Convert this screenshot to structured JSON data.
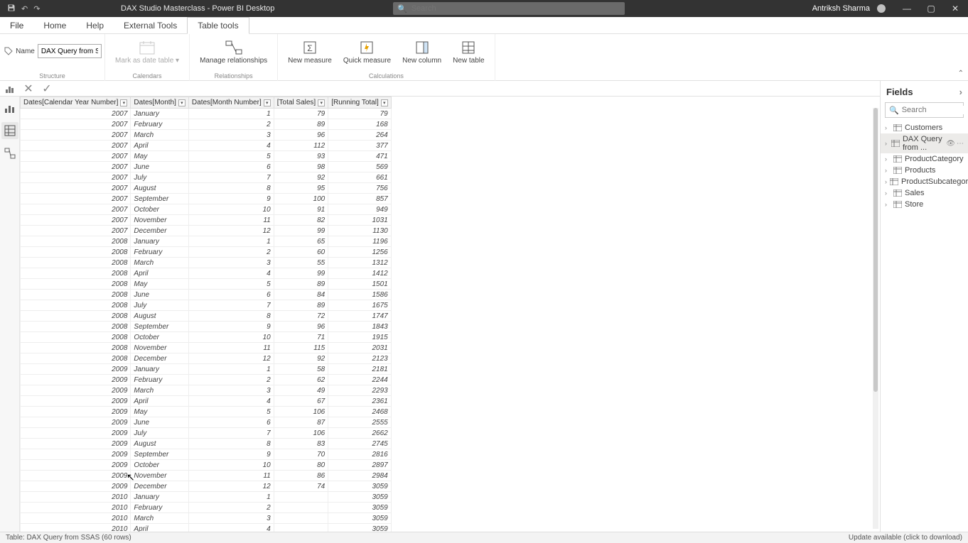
{
  "titlebar": {
    "title": "DAX Studio Masterclass - Power BI Desktop",
    "search_placeholder": "Search",
    "user": "Antriksh Sharma"
  },
  "tabs": {
    "file": "File",
    "home": "Home",
    "help": "Help",
    "external": "External Tools",
    "tabletools": "Table tools"
  },
  "ribbon": {
    "name_label": "Name",
    "name_value": "DAX Query from SS...",
    "mark_date": "Mark as date table",
    "manage_rel": "Manage relationships",
    "new_measure": "New measure",
    "quick_measure": "Quick measure",
    "new_column": "New column",
    "new_table": "New table",
    "g_structure": "Structure",
    "g_calendars": "Calendars",
    "g_relationships": "Relationships",
    "g_calculations": "Calculations"
  },
  "table": {
    "columns": [
      "Dates[Calendar Year Number]",
      "Dates[Month]",
      "Dates[Month Number]",
      "[Total Sales]",
      "[Running Total]"
    ],
    "rows": [
      [
        2007,
        "January",
        1,
        79,
        79
      ],
      [
        2007,
        "February",
        2,
        89,
        168
      ],
      [
        2007,
        "March",
        3,
        96,
        264
      ],
      [
        2007,
        "April",
        4,
        112,
        377
      ],
      [
        2007,
        "May",
        5,
        93,
        471
      ],
      [
        2007,
        "June",
        6,
        98,
        569
      ],
      [
        2007,
        "July",
        7,
        92,
        661
      ],
      [
        2007,
        "August",
        8,
        95,
        756
      ],
      [
        2007,
        "September",
        9,
        100,
        857
      ],
      [
        2007,
        "October",
        10,
        91,
        949
      ],
      [
        2007,
        "November",
        11,
        82,
        1031
      ],
      [
        2007,
        "December",
        12,
        99,
        1130
      ],
      [
        2008,
        "January",
        1,
        65,
        1196
      ],
      [
        2008,
        "February",
        2,
        60,
        1256
      ],
      [
        2008,
        "March",
        3,
        55,
        1312
      ],
      [
        2008,
        "April",
        4,
        99,
        1412
      ],
      [
        2008,
        "May",
        5,
        89,
        1501
      ],
      [
        2008,
        "June",
        6,
        84,
        1586
      ],
      [
        2008,
        "July",
        7,
        89,
        1675
      ],
      [
        2008,
        "August",
        8,
        72,
        1747
      ],
      [
        2008,
        "September",
        9,
        96,
        1843
      ],
      [
        2008,
        "October",
        10,
        71,
        1915
      ],
      [
        2008,
        "November",
        11,
        115,
        2031
      ],
      [
        2008,
        "December",
        12,
        92,
        2123
      ],
      [
        2009,
        "January",
        1,
        58,
        2181
      ],
      [
        2009,
        "February",
        2,
        62,
        2244
      ],
      [
        2009,
        "March",
        3,
        49,
        2293
      ],
      [
        2009,
        "April",
        4,
        67,
        2361
      ],
      [
        2009,
        "May",
        5,
        106,
        2468
      ],
      [
        2009,
        "June",
        6,
        87,
        2555
      ],
      [
        2009,
        "July",
        7,
        106,
        2662
      ],
      [
        2009,
        "August",
        8,
        83,
        2745
      ],
      [
        2009,
        "September",
        9,
        70,
        2816
      ],
      [
        2009,
        "October",
        10,
        80,
        2897
      ],
      [
        2009,
        "November",
        11,
        86,
        2984
      ],
      [
        2009,
        "December",
        12,
        74,
        3059
      ],
      [
        2010,
        "January",
        1,
        "",
        3059
      ],
      [
        2010,
        "February",
        2,
        "",
        3059
      ],
      [
        2010,
        "March",
        3,
        "",
        3059
      ],
      [
        2010,
        "April",
        4,
        "",
        3059
      ]
    ]
  },
  "fields": {
    "title": "Fields",
    "search_placeholder": "Search",
    "tables": [
      "Customers",
      "DAX Query from ...",
      "ProductCategory",
      "Products",
      "ProductSubcategory",
      "Sales",
      "Store"
    ],
    "selected_index": 1
  },
  "status": {
    "left": "Table: DAX Query from SSAS (60 rows)",
    "right": "Update available (click to download)"
  }
}
